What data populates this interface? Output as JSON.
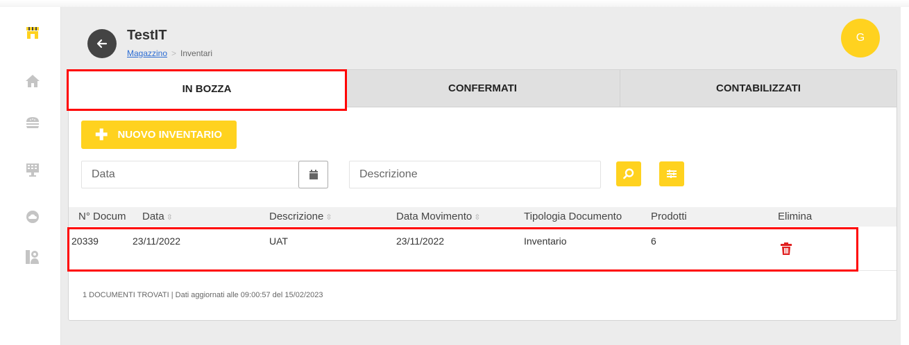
{
  "app": {
    "title": "TestIT"
  },
  "breadcrumb": {
    "parent": "Magazzino",
    "current": "Inventari"
  },
  "user": {
    "avatar_initial": "G"
  },
  "sidebar": {
    "items": [
      {
        "name": "store-icon"
      },
      {
        "name": "home-icon"
      },
      {
        "name": "burger-icon"
      },
      {
        "name": "pos-register-icon"
      },
      {
        "name": "cloud-icon"
      },
      {
        "name": "profile-settings-icon"
      }
    ]
  },
  "tabs": [
    {
      "label": "IN BOZZA",
      "active": true
    },
    {
      "label": "CONFERMATI",
      "active": false
    },
    {
      "label": "CONTABILIZZATI",
      "active": false
    }
  ],
  "toolbar": {
    "new_button_label": "NUOVO INVENTARIO",
    "date_placeholder": "Data",
    "description_placeholder": "Descrizione"
  },
  "table": {
    "headers": {
      "doc_number": "N° Docum",
      "date": "Data",
      "description": "Descrizione",
      "movement_date": "Data Movimento",
      "doc_type": "Tipologia Documento",
      "products": "Prodotti",
      "delete": "Elimina"
    },
    "rows": [
      {
        "doc_number": "20339",
        "date": "23/11/2022",
        "description": "UAT",
        "movement_date": "23/11/2022",
        "doc_type": "Inventario",
        "products": "6"
      }
    ]
  },
  "footer": {
    "status": "1 DOCUMENTI TROVATI | Dati aggiornati alle 09:00:57 del 15/02/2023"
  },
  "colors": {
    "accent": "#ffd21f",
    "highlight": "#ff0000",
    "delete": "#e02020",
    "back_button": "#444444"
  }
}
